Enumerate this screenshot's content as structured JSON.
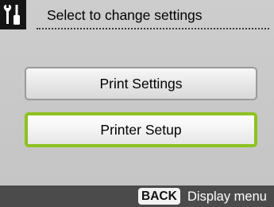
{
  "header": {
    "icon": "wrench-screwdriver-icon",
    "title": "Select to change settings"
  },
  "menu": {
    "items": [
      {
        "label": "Print Settings",
        "selected": false
      },
      {
        "label": "Printer Setup",
        "selected": true
      }
    ]
  },
  "footer": {
    "back_key": "BACK",
    "back_action": "Display menu"
  },
  "colors": {
    "background": "#c8c8c8",
    "header_icon_bg": "#151515",
    "selection_highlight": "#8ec21f",
    "footer_bg": "#4b4b4b"
  }
}
